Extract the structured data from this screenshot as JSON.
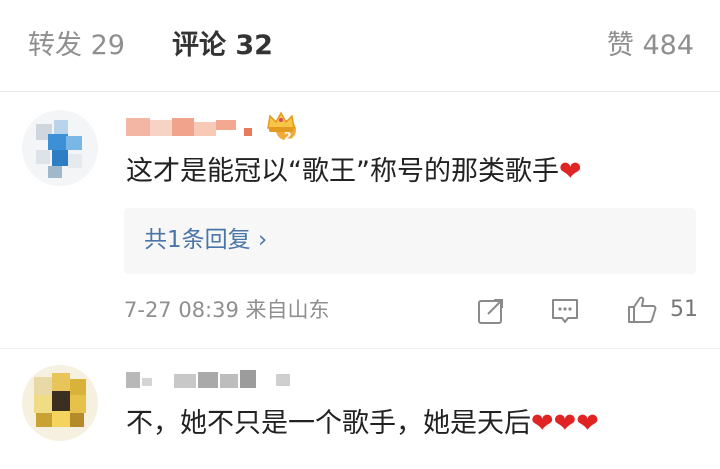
{
  "tabs": [
    {
      "label": "转发 29",
      "active": false
    },
    {
      "label": "评论 32",
      "active": true
    },
    {
      "label": "赞 484",
      "active": false
    }
  ],
  "comments": [
    {
      "text": "这才是能冠以“歌王”称号的那类歌手",
      "trailing_emoji": "❤",
      "replies_label": "共1条回复 ›",
      "meta": "7-27 08:39  来自山东",
      "like_count": "51"
    },
    {
      "text": "不，她不只是一个歌手，她是天后",
      "trailing_emoji": "❤❤❤"
    }
  ],
  "colors": {
    "accent_link": "#4a75a8",
    "heart": "#e02424",
    "muted": "#8f8f8f"
  },
  "icons": [
    "crown-badge-icon",
    "share-icon",
    "comment-icon",
    "thumbs-up-icon"
  ]
}
